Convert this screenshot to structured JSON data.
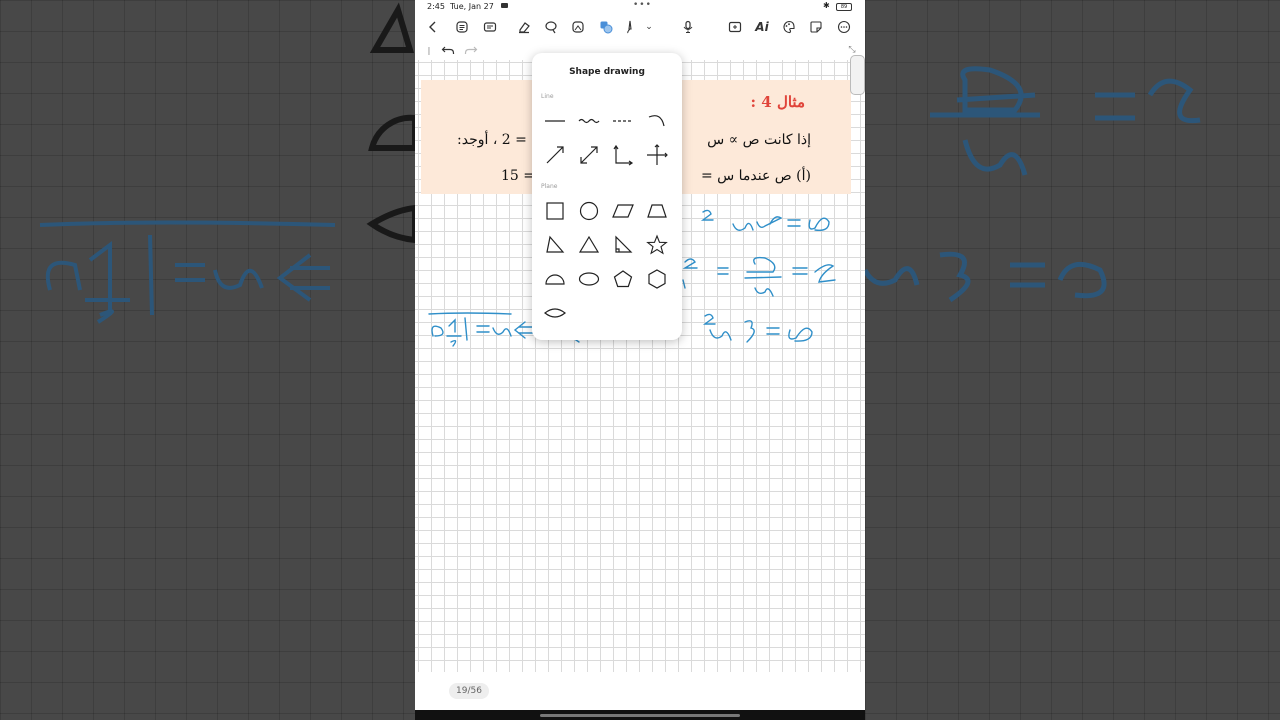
{
  "status": {
    "time": "2:45",
    "date": "Tue, Jan 27",
    "battery": "89"
  },
  "toolbar": {
    "icons": [
      "back-icon",
      "view-icon",
      "text-box-icon",
      "eraser-icon",
      "lasso-icon",
      "image-icon",
      "shape-icon",
      "pen-icon",
      "expand-icon",
      "microphone-icon",
      "screen-capture-icon",
      "ai-icon",
      "color-palette-icon",
      "sticker-icon",
      "more-icon"
    ],
    "ai_label": "Ai"
  },
  "note": {
    "example_title": "مثال 4 :",
    "line1_right": "إذا كانت ص ∝ س",
    "line1_left": "= 2 ، أوجد:",
    "line2_right": "(أ) ص عندما س =",
    "line2_left": "15 ="
  },
  "popup": {
    "title": "Shape drawing",
    "line_label": "Line",
    "plane_label": "Plane",
    "line_shapes": [
      "straight-line",
      "wavy-line",
      "dashed-line",
      "arc",
      "arrow",
      "double-arrow",
      "right-angle-axes",
      "crosshair-axes"
    ],
    "plane_shapes": [
      "square",
      "circle",
      "parallelogram",
      "trapezoid",
      "right-triangle-left",
      "triangle",
      "right-triangle-right",
      "star",
      "semicircle",
      "ellipse",
      "pentagon",
      "hexagon",
      "lens"
    ]
  },
  "pager": {
    "label": "19/56"
  },
  "colors": {
    "accent": "#4a8fd8",
    "ink": "#2f8fc9",
    "title_red": "#e0443a",
    "box_bg": "#fde9d9"
  }
}
